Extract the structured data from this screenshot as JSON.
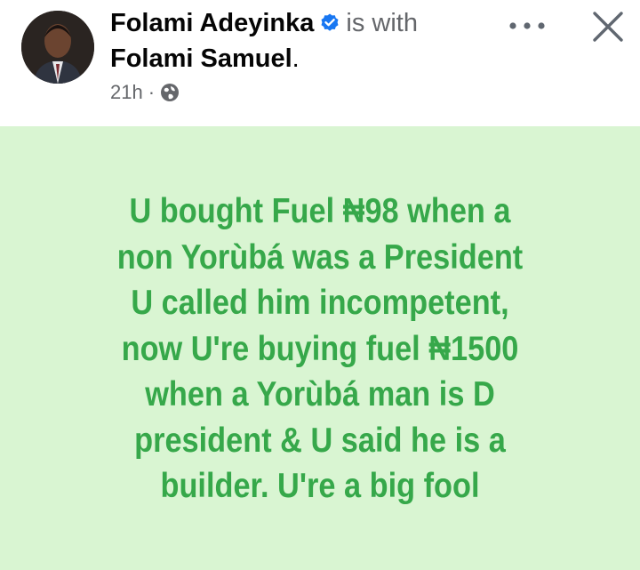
{
  "header": {
    "author": "Folami Adeyinka",
    "is_with": "is with",
    "tagged": "Folami Samuel",
    "tagged_suffix": ".",
    "time": "21h",
    "separator": "·",
    "privacy_icon": "globe-icon",
    "verified_icon": "verified-badge-icon",
    "more_icon": "more-options-icon",
    "close_icon": "close-icon",
    "verified_color": "#1877f2"
  },
  "post": {
    "background_color": "#d9f5d2",
    "text_color": "#36a84a",
    "lines": [
      "U bought Fuel ₦98 when a",
      "non Yorùbá was a President",
      "U called him incompetent,",
      "now U're buying fuel ₦1500",
      "when a Yorùbá man is D",
      "president & U said he is a",
      "builder. U're a big fool"
    ]
  }
}
